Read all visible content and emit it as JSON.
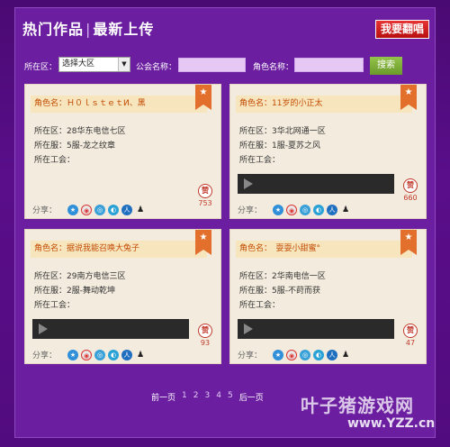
{
  "header": {
    "title_left": "热门作品",
    "title_sep": "|",
    "title_right": "最新上传",
    "request_button": "我要翻唱"
  },
  "filter": {
    "region_label": "所在区：",
    "region_selected": "选择大区",
    "guild_label": "公会名称：",
    "guild_value": "",
    "role_label": "角色名称：",
    "role_value": "",
    "search_button": "搜索"
  },
  "cards": [
    {
      "role_name": "角色名：Ｈ０ｌｓｔｅｔИ、黑",
      "region": "所在区：28华东电信七区",
      "server": "所在服：5服-龙之纹章",
      "guild": "所在工会：",
      "like_label": "赞",
      "like_count": "753",
      "share_label": "分享："
    },
    {
      "role_name": "角色名：11岁的小正太",
      "region": "所在区：3华北网通一区",
      "server": "所在服：1服-夏苏之风",
      "guild": "所在工会：",
      "like_label": "赞",
      "like_count": "660",
      "share_label": "分享："
    },
    {
      "role_name": "角色名：据说我能召唤大兔子",
      "region": "所在区：29南方电信三区",
      "server": "所在服：2服-舞动乾坤",
      "guild": "所在工会：",
      "like_label": "赞",
      "like_count": "93",
      "share_label": "分享："
    },
    {
      "role_name": "角色名：　耍耍小甜蜜°",
      "region": "所在区：2华南电信一区",
      "server": "所在服：5服-不莳而获",
      "guild": "所在工会：",
      "like_label": "赞",
      "like_count": "47",
      "share_label": "分享："
    }
  ],
  "share_icons": [
    "star-icon",
    "weibo-icon",
    "qzone-icon",
    "tencent-weibo-icon",
    "people-icon",
    "qq-icon"
  ],
  "pagination": {
    "prev": "前一页",
    "pages": [
      "1",
      "2",
      "3",
      "4",
      "5"
    ],
    "next": "后一页"
  },
  "watermark": {
    "line1": "叶子猪游戏网",
    "line2": "www.YZZ.cn"
  },
  "colors": {
    "accent_orange": "#e2702c",
    "like_red": "#c0392b",
    "purple_bg": "#6b1fa0"
  }
}
